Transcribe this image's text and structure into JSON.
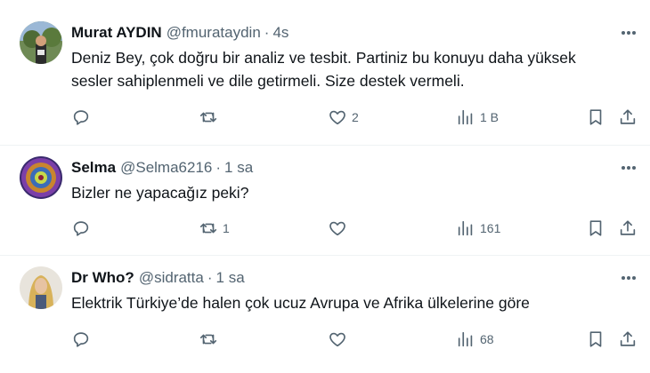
{
  "tweets": [
    {
      "name": "Murat AYDIN",
      "handle": "@fmurataydin",
      "separator": "·",
      "time": "4s",
      "lines": [
        "Deniz Bey, çok doğru bir analiz ve tesbit. Partiniz bu konuyu daha yüksek",
        "sesler sahiplenmeli ve dile getirmeli. Size destek vermeli."
      ],
      "reply_count": "",
      "retweet_count": "",
      "like_count": "2",
      "view_count": "1 B"
    },
    {
      "name": "Selma",
      "handle": "@Selma6216",
      "separator": "·",
      "time": "1 sa",
      "lines": [
        "Bizler ne yapacağız peki?"
      ],
      "reply_count": "",
      "retweet_count": "1",
      "like_count": "",
      "view_count": "161"
    },
    {
      "name": "Dr Who?",
      "handle": "@sidratta",
      "separator": "·",
      "time": "1 sa",
      "lines": [
        "Elektrik Türkiye’de halen çok ucuz Avrupa ve Afrika ülkelerine göre"
      ],
      "reply_count": "",
      "retweet_count": "",
      "like_count": "",
      "view_count": "68"
    }
  ],
  "icons": {
    "reply": "reply-icon",
    "retweet": "retweet-icon",
    "like": "heart-icon",
    "views": "views-icon",
    "bookmark": "bookmark-icon",
    "share": "share-icon",
    "more": "more-dots-icon"
  },
  "colors": {
    "text": "#0f1419",
    "secondary": "#536471",
    "divider": "#eff3f4"
  }
}
